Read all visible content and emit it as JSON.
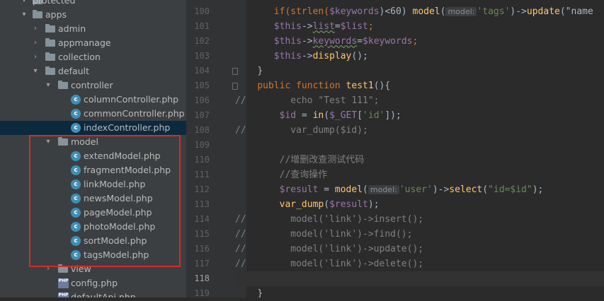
{
  "tree": {
    "items": [
      {
        "label": "protected",
        "type": "folder"
      },
      {
        "label": "apps",
        "type": "folder",
        "expanded": true
      },
      {
        "label": "admin",
        "type": "folder"
      },
      {
        "label": "appmanage",
        "type": "folder"
      },
      {
        "label": "collection",
        "type": "folder"
      },
      {
        "label": "default",
        "type": "folder",
        "expanded": true
      },
      {
        "label": "controller",
        "type": "folder",
        "expanded": true
      },
      {
        "label": "columnController.php",
        "type": "class"
      },
      {
        "label": "commonController.php",
        "type": "class"
      },
      {
        "label": "indexController.php",
        "type": "class",
        "selected": true
      },
      {
        "label": "model",
        "type": "folder",
        "expanded": true
      },
      {
        "label": "extendModel.php",
        "type": "class"
      },
      {
        "label": "fragmentModel.php",
        "type": "class"
      },
      {
        "label": "linkModel.php",
        "type": "class"
      },
      {
        "label": "newsModel.php",
        "type": "class"
      },
      {
        "label": "pageModel.php",
        "type": "class"
      },
      {
        "label": "photoModel.php",
        "type": "class"
      },
      {
        "label": "sortModel.php",
        "type": "class"
      },
      {
        "label": "tagsModel.php",
        "type": "class"
      },
      {
        "label": "view",
        "type": "folder"
      },
      {
        "label": "config.php",
        "type": "php"
      },
      {
        "label": "defaultApi.php",
        "type": "php"
      }
    ]
  },
  "editor": {
    "line_numbers": [
      "100",
      "101",
      "102",
      "103",
      "104",
      "105",
      "106",
      "107",
      "108",
      "109",
      "110",
      "111",
      "112",
      "113",
      "114",
      "115",
      "116",
      "117",
      "118",
      "119"
    ],
    "hints": {
      "model": "model:"
    },
    "code": {
      "l100_a": "if(strlen(",
      "l100_var": "$keywords",
      "l100_b": ")<60) ",
      "l100_fn": "model",
      "l100_c": "(",
      "l100_str": "'tags'",
      "l100_d": ")->",
      "l100_fn2": "update",
      "l100_e": "(\"name",
      "l101_this": "$this",
      "l101_a": "->",
      "l101_prop": "list",
      "l101_b": "=",
      "l101_var": "$list",
      "l101_c": ";",
      "l102_this": "$this",
      "l102_a": "->",
      "l102_prop": "keywords",
      "l102_b": "=",
      "l102_var": "$keywords",
      "l102_c": ";",
      "l103_this": "$this",
      "l103_a": "->",
      "l103_fn": "display",
      "l103_b": "();",
      "l104": "}",
      "l105_kw": "public function ",
      "l105_fn": "test1",
      "l105_b": "(){",
      "l106": "//        echo \"Test 111\";",
      "l107_var": "$id",
      "l107_a": " = ",
      "l107_fn": "in",
      "l107_b": "(",
      "l107_var2": "$_GET",
      "l107_c": "[",
      "l107_str": "'id'",
      "l107_d": "]);",
      "l108": "//        var_dump($id);",
      "l110": "//增删改查测试代码",
      "l111": "//查询操作",
      "l112_var": "$result",
      "l112_a": " = ",
      "l112_fn": "model",
      "l112_b": "(",
      "l112_str": "'user'",
      "l112_c": ")->",
      "l112_fn2": "select",
      "l112_d": "(",
      "l112_str2": "\"id=$id\"",
      "l112_e": ");",
      "l113_fn": "var_dump",
      "l113_a": "(",
      "l113_var": "$result",
      "l113_b": ");",
      "l114": "//        model('link')->insert();",
      "l115": "//        model('link')->find();",
      "l116": "//        model('link')->update();",
      "l117": "//        model('link')->delete();",
      "l119": "}"
    }
  },
  "colors": {
    "highlight_box": "#d52b2b",
    "selected_row": "#0d293e"
  }
}
